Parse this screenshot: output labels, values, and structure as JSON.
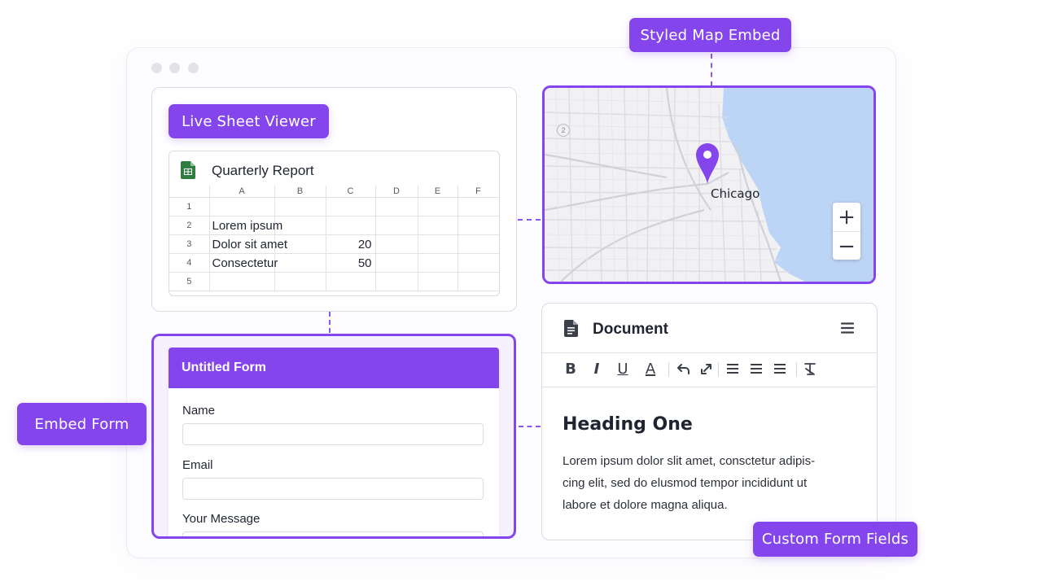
{
  "callouts": {
    "styled_map": "Styled Map Embed",
    "live_sheet": "Live Sheet Viewer",
    "embed_form": "Embed Form",
    "custom_fields": "Custom Form Fields"
  },
  "sheet": {
    "title": "Quarterly Report",
    "columns": [
      "A",
      "B",
      "C",
      "D",
      "E",
      "F"
    ],
    "rows": [
      {
        "num": "1",
        "cells": [
          "",
          "",
          "",
          "",
          "",
          ""
        ]
      },
      {
        "num": "2",
        "cells": [
          "Lorem ipsum",
          "",
          "",
          "",
          "",
          ""
        ]
      },
      {
        "num": "3",
        "cells": [
          "Dolor sit amet",
          "",
          "20",
          "",
          "",
          ""
        ]
      },
      {
        "num": "4",
        "cells": [
          "Consectetur",
          "",
          "50",
          "",
          "",
          ""
        ]
      },
      {
        "num": "5",
        "cells": [
          "",
          "",
          "",
          "",
          "",
          ""
        ]
      }
    ]
  },
  "map": {
    "label": "Chicago",
    "highway_marker": "2",
    "zoom_in": "+",
    "zoom_out": "−",
    "colors": {
      "water": "#bcd4f5",
      "land": "#f1f1f4",
      "pin": "#8446ec"
    }
  },
  "form": {
    "title": "Untitled Form",
    "fields": [
      {
        "label": "Name",
        "value": ""
      },
      {
        "label": "Email",
        "value": ""
      },
      {
        "label": "Your Message",
        "value": ""
      }
    ]
  },
  "document": {
    "title": "Document",
    "toolbar": [
      "B",
      "I",
      "U",
      "A"
    ],
    "heading": "Heading One",
    "body_lines": [
      "Lorem ipsum dolor slit  amet, consctetur adipis-",
      "cing elit, sed do elusmod tempor incididunt ut",
      "labore et dolore magna aliqua."
    ]
  },
  "colors": {
    "accent": "#8446ec",
    "border": "#dcdbe4"
  }
}
